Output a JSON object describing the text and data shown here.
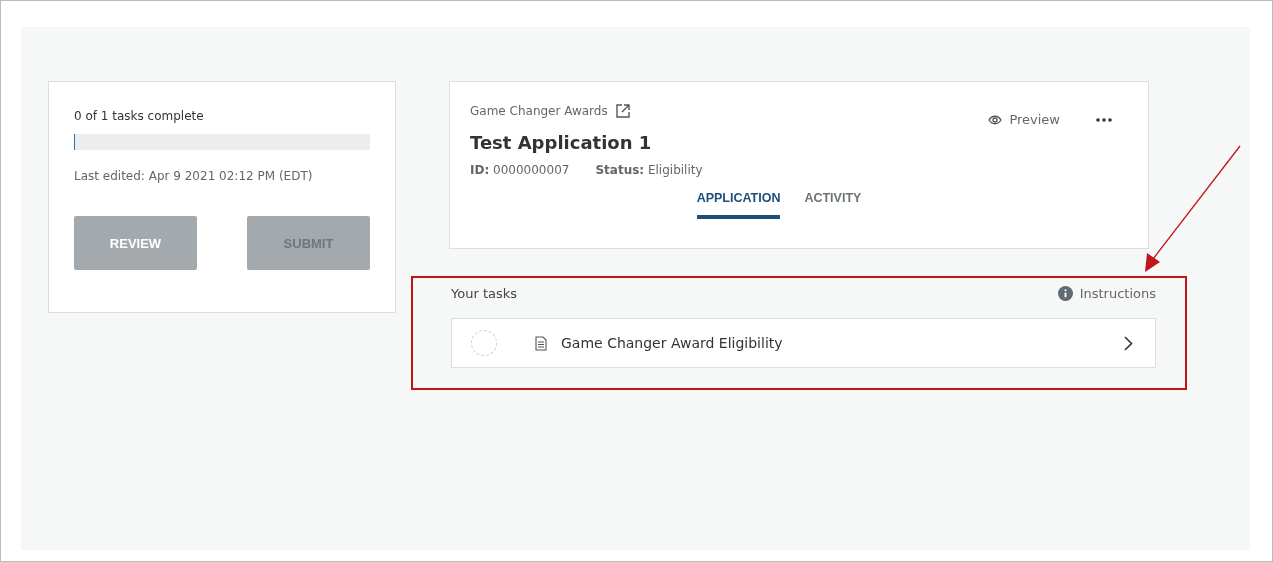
{
  "progress": {
    "label": "0 of 1 tasks complete",
    "level": 0,
    "last_edited": "Last edited: Apr 9 2021 02:12 PM (EDT)"
  },
  "actions": [
    {
      "label": "REVIEW",
      "disabled": false
    },
    {
      "label": "SUBMIT",
      "disabled": true
    }
  ],
  "application": {
    "program": "Game Changer Awards",
    "title": "Test Application 1",
    "id_label": "ID:",
    "id_value": "0000000007",
    "status_label": "Status:",
    "status_value": "Eligibility",
    "preview": "Preview"
  },
  "tabs": [
    {
      "label": "APPLICATION",
      "selected": true
    },
    {
      "label": "ACTIVITY",
      "selected": false
    }
  ],
  "tasks": {
    "heading": "Your tasks",
    "instructions": "Instructions",
    "highlighted": true,
    "items": [
      {
        "label": "Game Changer Award Eligibility",
        "complete": false
      }
    ]
  }
}
